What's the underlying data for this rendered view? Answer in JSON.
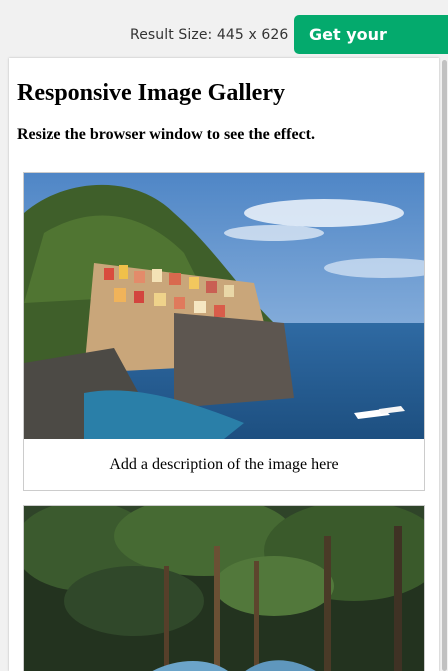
{
  "toolbar": {
    "result_size": "Result Size: 445 x 626",
    "cta_label": "Get your website"
  },
  "page": {
    "title": "Responsive Image Gallery",
    "subtitle": "Resize the browser window to see the effect."
  },
  "gallery": [
    {
      "description": "Add a description of the image here"
    },
    {
      "description": ""
    }
  ]
}
